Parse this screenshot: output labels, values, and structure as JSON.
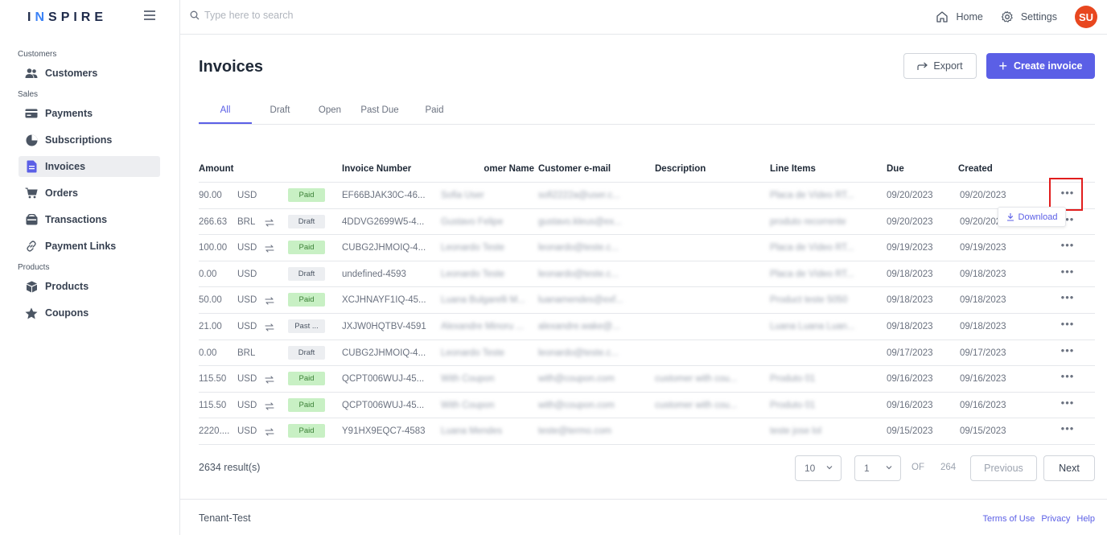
{
  "brand": {
    "logo_pre": "I",
    "logo_accent": "N",
    "logo_post": "SPIRE"
  },
  "search": {
    "placeholder": "Type here to search"
  },
  "topnav": {
    "home": "Home",
    "settings": "Settings",
    "avatar_initials": "SU"
  },
  "sidebar": {
    "sections": [
      {
        "label": "Customers",
        "items": [
          {
            "label": "Customers",
            "icon": "users-icon"
          }
        ]
      },
      {
        "label": "Sales",
        "items": [
          {
            "label": "Payments",
            "icon": "credit-card-icon"
          },
          {
            "label": "Subscriptions",
            "icon": "pie-chart-icon"
          },
          {
            "label": "Invoices",
            "icon": "document-icon",
            "active": true
          },
          {
            "label": "Orders",
            "icon": "cart-icon"
          },
          {
            "label": "Transactions",
            "icon": "wallet-icon"
          },
          {
            "label": "Payment Links",
            "icon": "link-icon"
          }
        ]
      },
      {
        "label": "Products",
        "items": [
          {
            "label": "Products",
            "icon": "box-icon"
          },
          {
            "label": "Coupons",
            "icon": "star-icon"
          }
        ]
      }
    ]
  },
  "page": {
    "title": "Invoices",
    "export_label": "Export",
    "create_label": "Create invoice",
    "tabs": [
      "All",
      "Draft",
      "Open",
      "Past Due",
      "Paid"
    ],
    "active_tab": "All"
  },
  "table": {
    "columns": [
      "Amount",
      "Invoice Number",
      "omer Name",
      "Customer e-mail",
      "Description",
      "Line Items",
      "Due",
      "Created"
    ],
    "rows": [
      {
        "amount": "90.00",
        "currency": "USD",
        "recurring": false,
        "status": "Paid",
        "status_type": "paid",
        "invoice": "EF66BJAK30C-46...",
        "name": "Sofia User",
        "email": "sofi2222a@user.c...",
        "description": "",
        "line_items": "Placa de Vídeo RT...",
        "due": "09/20/2023",
        "created": "09/20/2023"
      },
      {
        "amount": "266.63",
        "currency": "BRL",
        "recurring": true,
        "status": "Draft",
        "status_type": "draft",
        "invoice": "4DDVG2699W5-4...",
        "name": "Gustavo Felipe",
        "email": "gustavo.kleus@ex...",
        "description": "",
        "line_items": "produto recorrente",
        "due": "09/20/2023",
        "created": "09/20/2023"
      },
      {
        "amount": "100.00",
        "currency": "USD",
        "recurring": true,
        "status": "Paid",
        "status_type": "paid",
        "invoice": "CUBG2JHMOIQ-4...",
        "name": "Leonardo Teste",
        "email": "leonardo@teste.c...",
        "description": "",
        "line_items": "Placa de Vídeo RT...",
        "due": "09/19/2023",
        "created": "09/19/2023"
      },
      {
        "amount": "0.00",
        "currency": "USD",
        "recurring": false,
        "status": "Draft",
        "status_type": "draft",
        "invoice": "undefined-4593",
        "name": "Leonardo Teste",
        "email": "leonardo@teste.c...",
        "description": "",
        "line_items": "Placa de Vídeo RT...",
        "due": "09/18/2023",
        "created": "09/18/2023"
      },
      {
        "amount": "50.00",
        "currency": "USD",
        "recurring": true,
        "status": "Paid",
        "status_type": "paid",
        "invoice": "XCJHNAYF1IQ-45...",
        "name": "Luana Bulgarelli M...",
        "email": "luanamendes@exf...",
        "description": "",
        "line_items": "Product teste 5050",
        "due": "09/18/2023",
        "created": "09/18/2023"
      },
      {
        "amount": "21.00",
        "currency": "USD",
        "recurring": true,
        "status": "Past ...",
        "status_type": "past",
        "invoice": "JXJW0HQTBV-4591",
        "name": "Alexandre Minoru ...",
        "email": "alexandre.wake@...",
        "description": "",
        "line_items": "Luana Luana Luan...",
        "due": "09/18/2023",
        "created": "09/18/2023"
      },
      {
        "amount": "0.00",
        "currency": "BRL",
        "recurring": false,
        "status": "Draft",
        "status_type": "draft",
        "invoice": "CUBG2JHMOIQ-4...",
        "name": "Leonardo Teste",
        "email": "leonardo@teste.c...",
        "description": "",
        "line_items": "",
        "due": "09/17/2023",
        "created": "09/17/2023"
      },
      {
        "amount": "115.50",
        "currency": "USD",
        "recurring": true,
        "status": "Paid",
        "status_type": "paid",
        "invoice": "QCPT006WUJ-45...",
        "name": "With Coupon",
        "email": "with@coupon.com",
        "description": "customer with cou...",
        "line_items": "Produto 01",
        "due": "09/16/2023",
        "created": "09/16/2023"
      },
      {
        "amount": "115.50",
        "currency": "USD",
        "recurring": true,
        "status": "Paid",
        "status_type": "paid",
        "invoice": "QCPT006WUJ-45...",
        "name": "With Coupon",
        "email": "with@coupon.com",
        "description": "customer with cou...",
        "line_items": "Produto 01",
        "due": "09/16/2023",
        "created": "09/16/2023"
      },
      {
        "amount": "2220....",
        "currency": "USD",
        "recurring": true,
        "status": "Paid",
        "status_type": "paid",
        "invoice": "Y91HX9EQC7-4583",
        "name": "Luana Mendes",
        "email": "teste@termo.com",
        "description": "",
        "line_items": "teste jose lol",
        "due": "09/15/2023",
        "created": "09/15/2023"
      }
    ],
    "more_label": "•••",
    "dropdown_download": "Download"
  },
  "pagination": {
    "results": "2634 result(s)",
    "page_size": "10",
    "current_page": "1",
    "of_label": "OF",
    "total_pages": "264",
    "previous": "Previous",
    "next": "Next"
  },
  "footer": {
    "tenant": "Tenant-Test",
    "links": [
      "Terms of Use",
      "Privacy",
      "Help"
    ]
  },
  "colors": {
    "accent": "#5b5fe6",
    "avatar": "#e8471f",
    "paid_bg": "#c8f0c4",
    "highlight": "#e11d1d"
  }
}
